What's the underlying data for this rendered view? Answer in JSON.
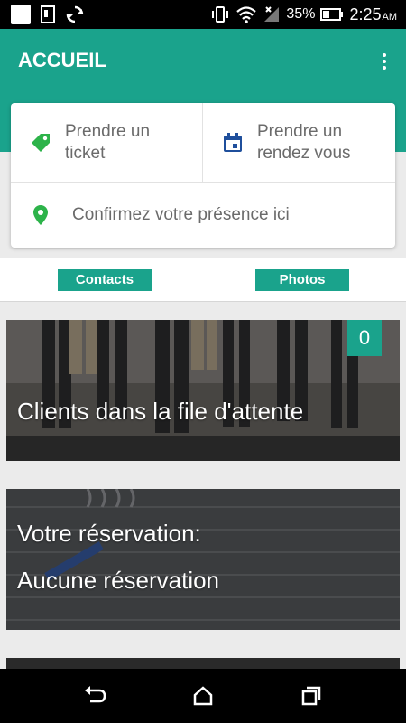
{
  "status_bar": {
    "battery_percent": "35%",
    "time": "2:25",
    "ampm": "AM"
  },
  "app_bar": {
    "title": "ACCUEIL"
  },
  "actions": {
    "ticket_line1": "Prendre un",
    "ticket_line2": "ticket",
    "rdv_line1": "Prendre un",
    "rdv_line2": "rendez vous",
    "presence": "Confirmez votre présence ici"
  },
  "tabs": {
    "contacts": "Contacts",
    "photos": "Photos"
  },
  "queue_card": {
    "title": "Clients dans la file d'attente",
    "count": "0"
  },
  "reservation_card": {
    "title": "Votre réservation:",
    "value": "Aucune réservation"
  },
  "colors": {
    "accent": "#1aa38c",
    "ticket_icon": "#2db34a",
    "calendar_icon": "#1f4f9c",
    "location_icon": "#2db34a"
  }
}
